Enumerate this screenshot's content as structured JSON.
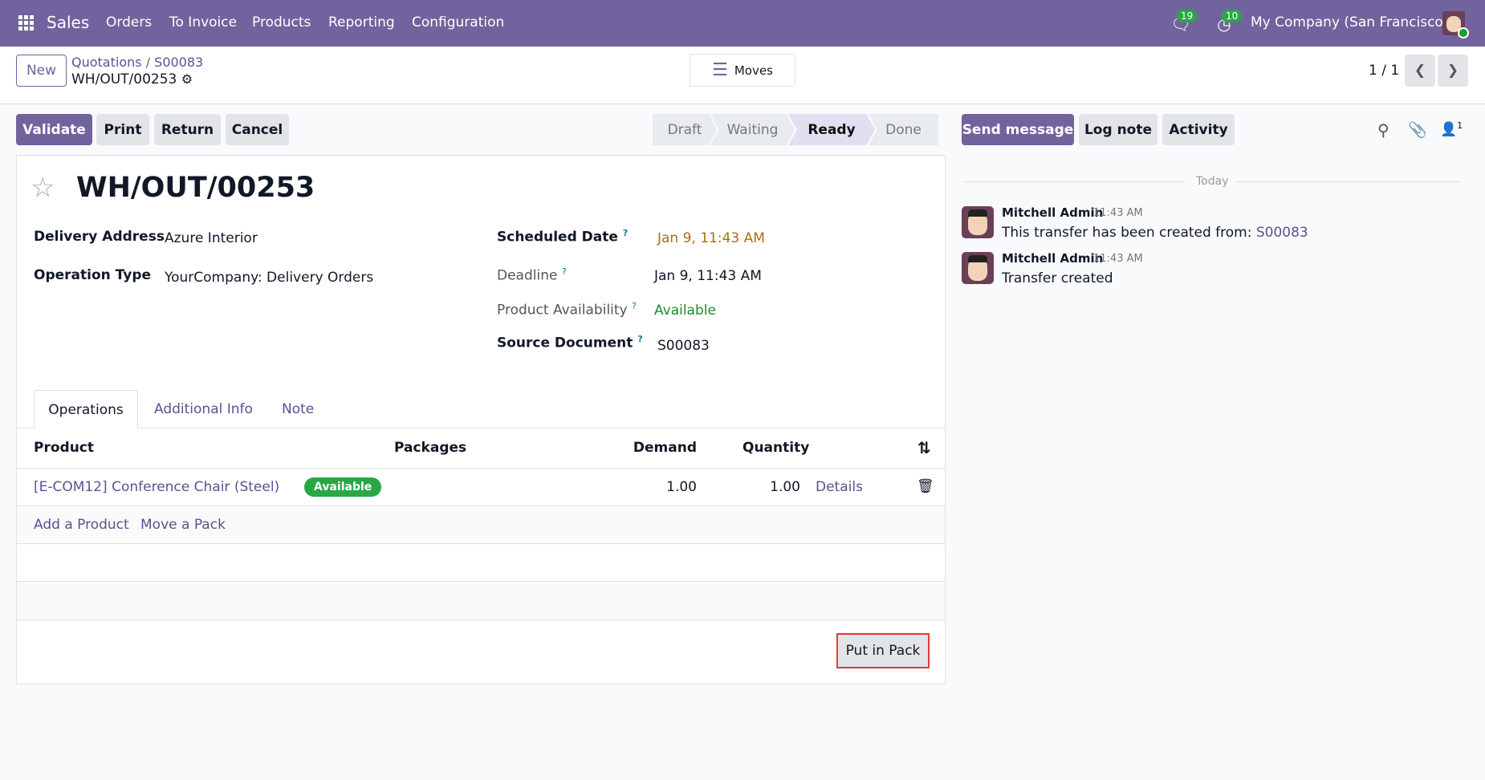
{
  "navbar": {
    "app": "Sales",
    "menu": [
      "Orders",
      "To Invoice",
      "Products",
      "Reporting",
      "Configuration"
    ],
    "messages_count": "19",
    "activity_count": "10",
    "company": "My Company (San Francisco)"
  },
  "control": {
    "new_label": "New",
    "breadcrumb": [
      "Quotations",
      "S00083"
    ],
    "record": "WH/OUT/00253",
    "moves_label": "Moves",
    "pager": "1 / 1"
  },
  "actions": {
    "validate": "Validate",
    "print": "Print",
    "return": "Return",
    "cancel": "Cancel"
  },
  "status": {
    "steps": [
      "Draft",
      "Waiting",
      "Ready",
      "Done"
    ],
    "current": "Ready"
  },
  "form": {
    "title": "WH/OUT/00253",
    "delivery_address_label": "Delivery Address",
    "delivery_address": "Azure Interior",
    "operation_type_label": "Operation Type",
    "operation_type": "YourCompany: Delivery Orders",
    "scheduled_date_label": "Scheduled Date",
    "scheduled_date": "Jan 9, 11:43 AM",
    "deadline_label": "Deadline",
    "deadline": "Jan 9, 11:43 AM",
    "availability_label": "Product Availability",
    "availability": "Available",
    "source_label": "Source Document",
    "source": "S00083",
    "help": "?",
    "tabs": [
      "Operations",
      "Additional Info",
      "Note"
    ],
    "columns": [
      "Product",
      "Packages",
      "Demand",
      "Quantity"
    ],
    "rows": [
      {
        "product": "[E-COM12] Conference Chair (Steel)",
        "badge": "Available",
        "demand": "1.00",
        "quantity": "1.00",
        "details": "Details"
      }
    ],
    "add_product": "Add a Product",
    "move_pack": "Move a Pack",
    "put_in_pack": "Put in Pack"
  },
  "chatter": {
    "send": "Send message",
    "log": "Log note",
    "activity": "Activity",
    "followers": "1",
    "today": "Today",
    "messages": [
      {
        "author": "Mitchell Admin",
        "time": "11:43 AM",
        "text": "This transfer has been created from: ",
        "link": "S00083"
      },
      {
        "author": "Mitchell Admin",
        "time": "11:43 AM",
        "text": "Transfer created"
      }
    ]
  },
  "colors": {
    "brand": "#71639e",
    "success": "#28a745",
    "warning_date": "#a57110"
  }
}
